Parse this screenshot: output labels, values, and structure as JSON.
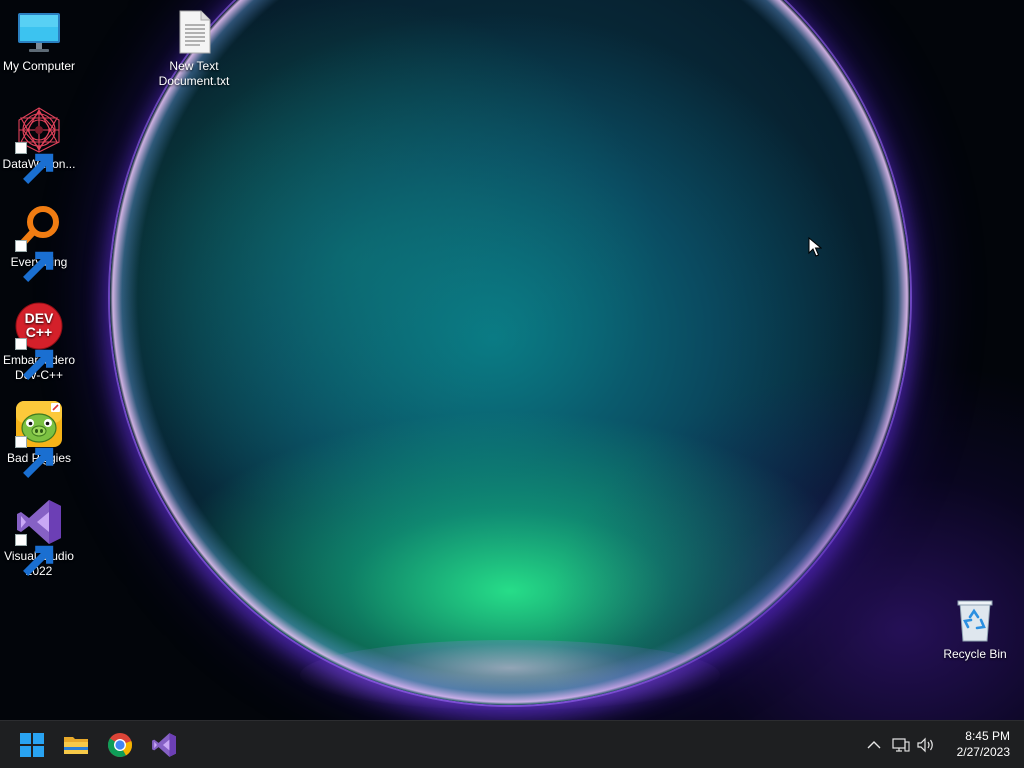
{
  "desktop": {
    "icons": [
      {
        "label_line1": "My Computer",
        "label_line2": "",
        "icon": "monitor-icon",
        "shortcut": false
      },
      {
        "label_line1": "New Text",
        "label_line2": "Document.txt",
        "icon": "text-file-icon",
        "shortcut": false
      },
      {
        "label_line1": "DataWagon...",
        "label_line2": "",
        "icon": "datawagon-icon",
        "shortcut": true
      },
      {
        "label_line1": "Everything",
        "label_line2": "",
        "icon": "everything-magnifier-icon",
        "shortcut": true
      },
      {
        "label_line1": "Embarcadero",
        "label_line2": "Dev-C++",
        "icon": "devcpp-icon",
        "shortcut": true
      },
      {
        "label_line1": "Bad Piggies",
        "label_line2": "",
        "icon": "bad-piggies-icon",
        "shortcut": true
      },
      {
        "label_line1": "Visual Studio",
        "label_line2": "2022",
        "icon": "visual-studio-icon",
        "shortcut": true
      },
      {
        "label_line1": "Recycle Bin",
        "label_line2": "",
        "icon": "recycle-bin-icon",
        "shortcut": false
      }
    ],
    "devcpp_badge_line1": "DEV",
    "devcpp_badge_line2": "C++"
  },
  "taskbar": {
    "pinned": [
      {
        "name": "start",
        "icon": "windows-start-icon"
      },
      {
        "name": "file-explorer",
        "icon": "folder-icon"
      },
      {
        "name": "chrome",
        "icon": "chrome-icon"
      },
      {
        "name": "visual-studio",
        "icon": "visual-studio-icon"
      }
    ],
    "tray": {
      "chevron_icon": "chevron-up-icon",
      "network_icon": "network-icon",
      "volume_icon": "speaker-icon"
    },
    "clock": {
      "time": "8:45 PM",
      "date": "2/27/2023"
    }
  },
  "colors": {
    "taskbar_bg": "#1e1f21",
    "win_blue": "#29a3f2",
    "vs_purple": "#8661c5"
  }
}
